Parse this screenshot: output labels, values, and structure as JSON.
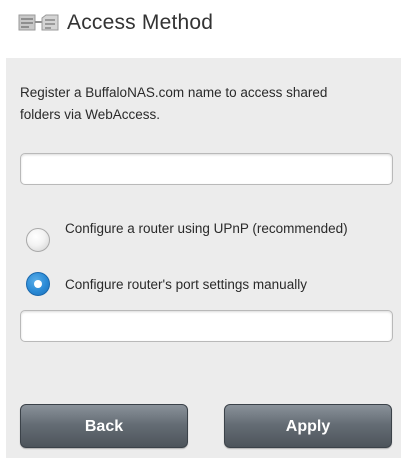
{
  "header": {
    "title": "Access Method",
    "icon": "folder-network-icon"
  },
  "description": "Register a BuffaloNAS.com name to access shared folders via WebAccess.",
  "name_input": {
    "value": "",
    "placeholder": ""
  },
  "options": [
    {
      "label": "Configure a router using UPnP (recommended)",
      "selected": false
    },
    {
      "label": "Configure router's port settings manually",
      "selected": true
    }
  ],
  "port_input": {
    "value": "",
    "placeholder": ""
  },
  "buttons": {
    "back_label": "Back",
    "apply_label": "Apply"
  },
  "colors": {
    "radio_selected": "#2a8ad6",
    "button": "#656d75",
    "panel_background": "#ececec"
  }
}
